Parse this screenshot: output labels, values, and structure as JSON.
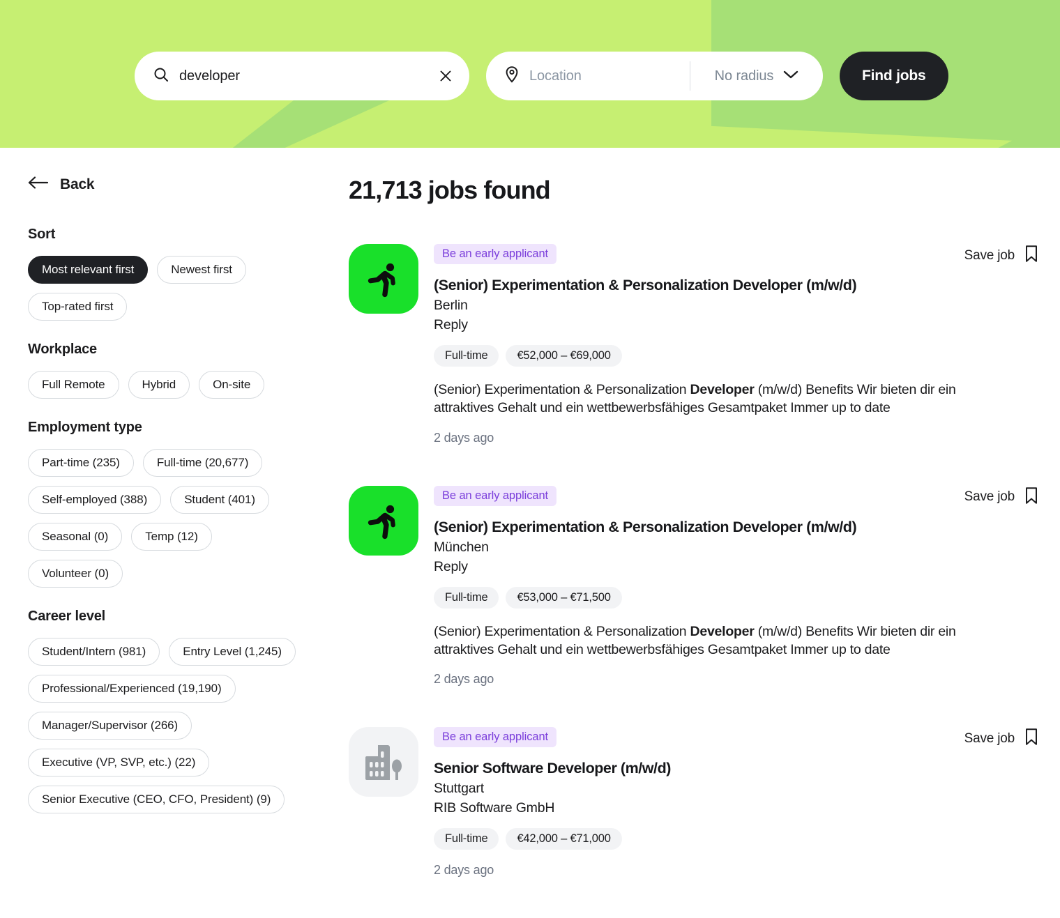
{
  "header": {
    "search": {
      "icon": "search-icon",
      "value": "developer",
      "clear_icon": "close-icon"
    },
    "location": {
      "icon": "map-pin-icon",
      "placeholder": "Location",
      "radius_value": "No radius",
      "radius_icon": "chevron-down-icon"
    },
    "find_jobs_label": "Find jobs",
    "colors": {
      "background": "#c6ef72",
      "accent_shape": "#a6e076",
      "button": "#1f2125"
    }
  },
  "sidebar": {
    "back_label": "Back",
    "back_icon": "arrow-left-icon",
    "groups": [
      {
        "heading": "Sort",
        "chips": [
          {
            "label": "Most relevant first",
            "selected": true
          },
          {
            "label": "Newest first",
            "selected": false
          },
          {
            "label": "Top-rated first",
            "selected": false
          }
        ]
      },
      {
        "heading": "Workplace",
        "chips": [
          {
            "label": "Full Remote",
            "selected": false
          },
          {
            "label": "Hybrid",
            "selected": false
          },
          {
            "label": "On-site",
            "selected": false
          }
        ]
      },
      {
        "heading": "Employment type",
        "chips": [
          {
            "label": "Part-time (235)",
            "selected": false
          },
          {
            "label": "Full-time (20,677)",
            "selected": false
          },
          {
            "label": "Self-employed (388)",
            "selected": false
          },
          {
            "label": "Student (401)",
            "selected": false
          },
          {
            "label": "Seasonal (0)",
            "selected": false
          },
          {
            "label": "Temp (12)",
            "selected": false
          },
          {
            "label": "Volunteer (0)",
            "selected": false
          }
        ]
      },
      {
        "heading": "Career level",
        "chips": [
          {
            "label": "Student/Intern (981)",
            "selected": false
          },
          {
            "label": "Entry Level (1,245)",
            "selected": false
          },
          {
            "label": "Professional/Experienced (19,190)",
            "selected": false
          },
          {
            "label": "Manager/Supervisor (266)",
            "selected": false
          },
          {
            "label": "Executive (VP, SVP, etc.) (22)",
            "selected": false
          },
          {
            "label": "Senior Executive (CEO, CFO, President) (9)",
            "selected": false
          }
        ]
      }
    ]
  },
  "results": {
    "title": "21,713 jobs found",
    "save_job_label": "Save job",
    "save_job_icon": "bookmark-icon",
    "early_badge_label": "Be an early applicant",
    "jobs": [
      {
        "logo": "runner-icon",
        "logo_style": "green",
        "badge": "Be an early applicant",
        "title": "(Senior) Experimentation & Personalization Developer (m/w/d)",
        "location": "Berlin",
        "company": "Reply",
        "tags": [
          "Full-time",
          "€52,000 – €69,000"
        ],
        "snippet_before": "(Senior) Experimentation & Personalization ",
        "snippet_bold": "Developer",
        "snippet_after": " (m/w/d) Benefits Wir bieten dir ein attraktives Gehalt und ein wettbewerbsfähiges Gesamtpaket Immer up to date",
        "time": "2 days ago",
        "save_label": "Save job"
      },
      {
        "logo": "runner-icon",
        "logo_style": "green",
        "badge": "Be an early applicant",
        "title": "(Senior) Experimentation & Personalization Developer (m/w/d)",
        "location": "München",
        "company": "Reply",
        "tags": [
          "Full-time",
          "€53,000 – €71,500"
        ],
        "snippet_before": "(Senior) Experimentation & Personalization ",
        "snippet_bold": "Developer",
        "snippet_after": " (m/w/d) Benefits Wir bieten dir ein attraktives Gehalt und ein wettbewerbsfähiges Gesamtpaket Immer up to date",
        "time": "2 days ago",
        "save_label": "Save job"
      },
      {
        "logo": "building-icon",
        "logo_style": "placeholder",
        "badge": "Be an early applicant",
        "title": "Senior Software Developer (m/w/d)",
        "location": "Stuttgart",
        "company": "RIB Software GmbH",
        "tags": [
          "Full-time",
          "€42,000 – €71,000"
        ],
        "snippet_before": "",
        "snippet_bold": "",
        "snippet_after": "",
        "time": "2 days ago",
        "save_label": "Save job"
      }
    ]
  }
}
